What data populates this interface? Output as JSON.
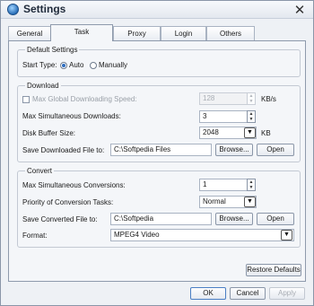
{
  "window": {
    "title": "Settings"
  },
  "tabs": [
    "General",
    "Task",
    "Proxy",
    "Login",
    "Others"
  ],
  "default_settings": {
    "legend": "Default Settings",
    "start_type_label": "Start Type:",
    "options": [
      "Auto",
      "Manually"
    ],
    "selected": "Auto"
  },
  "download": {
    "legend": "Download",
    "max_speed_label": "Max Global Downloading Speed:",
    "max_speed_checked": false,
    "max_speed_value": "128",
    "max_speed_unit": "KB/s",
    "max_downloads_label": "Max Simultaneous Downloads:",
    "max_downloads_value": "3",
    "buffer_label": "Disk Buffer Size:",
    "buffer_value": "2048",
    "buffer_unit": "KB",
    "save_label": "Save Downloaded File to:",
    "save_path": "C:\\Softpedia Files",
    "browse_label": "Browse...",
    "open_label": "Open"
  },
  "convert": {
    "legend": "Convert",
    "max_conv_label": "Max Simultaneous Conversions:",
    "max_conv_value": "1",
    "priority_label": "Priority of Conversion Tasks:",
    "priority_value": "Normal",
    "save_label": "Save Converted File to:",
    "save_path": "C:\\Softpedia",
    "browse_label": "Browse...",
    "open_label": "Open",
    "format_label": "Format:",
    "format_value": "MPEG4 Video"
  },
  "buttons": {
    "restore": "Restore Defaults",
    "ok": "OK",
    "cancel": "Cancel",
    "apply": "Apply"
  }
}
